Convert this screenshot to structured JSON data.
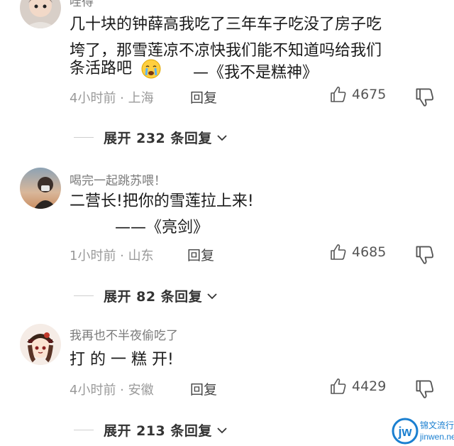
{
  "comments": [
    {
      "username": "哇得",
      "lines": [
        "几十块的钟薛高我吃了三年车子吃没了房子吃",
        "垮了，那雪莲凉不凉快我们能不知道吗给我们",
        "条活路吧"
      ],
      "attribution": "—《我不是糕神》",
      "emoji": "crying-face-emoji",
      "time_location": "4小时前 · 上海",
      "reply_label": "回复",
      "likes": "4675",
      "expand_label": "展开 232 条回复"
    },
    {
      "username": "喝完一起跳苏喂！",
      "lines": [
        "二营长!把你的雪莲拉上来!"
      ],
      "attribution": "——《亮剑》",
      "time_location": "1小时前 · 山东",
      "reply_label": "回复",
      "likes": "4685",
      "expand_label": "展开 82 条回复"
    },
    {
      "username": "我再也不半夜偷吃了",
      "lines": [
        "打 的 一 糕 开!"
      ],
      "time_location": "4小时前 · 安徽",
      "reply_label": "回复",
      "likes": "4429",
      "expand_label": "展开 213 条回复"
    }
  ],
  "watermark": {
    "logo": "jw",
    "title": "锦文流行语",
    "url": "jinwen.net"
  },
  "colors": {
    "meta_gray": "#9a9a9a",
    "username_gray": "#7a7a7a",
    "text_dark": "#1a1a1a",
    "watermark_blue": "#1a7fd0"
  },
  "icons": [
    "thumbs-up-icon",
    "thumbs-down-icon",
    "chevron-down-icon"
  ]
}
